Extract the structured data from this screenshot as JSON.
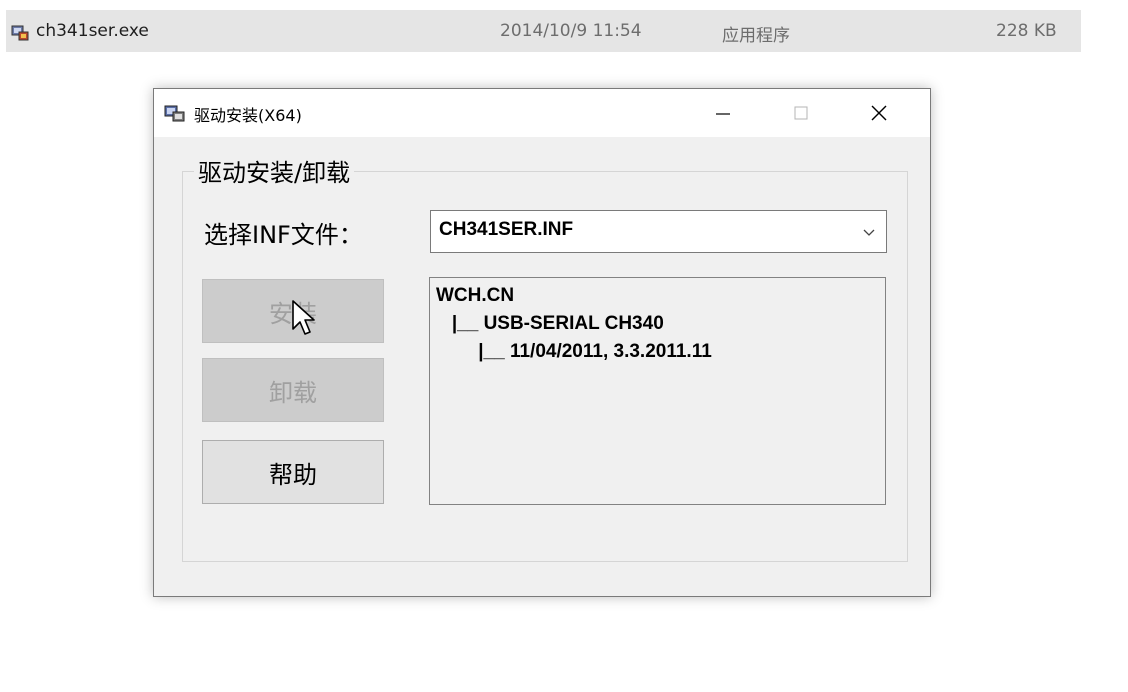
{
  "file_row": {
    "icon": "setup-exe-icon",
    "name": "ch341ser.exe",
    "date": "2014/10/9 11:54",
    "type": "应用程序",
    "size": "228 KB"
  },
  "dialog": {
    "title": "驱动安装(X64)",
    "title_icon": "installer-icon",
    "controls": {
      "minimize": "—",
      "maximize": "□",
      "close": "✕"
    },
    "group_title": "驱动安装/卸载",
    "inf_label": "选择INF文件：",
    "inf_value": "CH341SER.INF",
    "buttons": {
      "install": "安装",
      "uninstall": "卸载",
      "help": "帮助"
    },
    "info_lines": [
      "WCH.CN",
      "   |__ USB-SERIAL CH340",
      "        |__ 11/04/2011, 3.3.2011.11"
    ]
  }
}
